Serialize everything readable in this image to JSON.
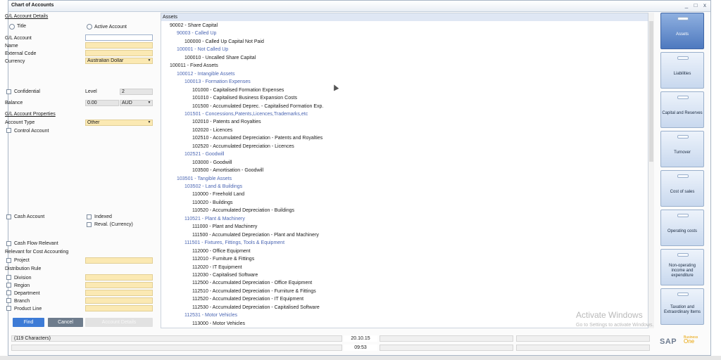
{
  "window": {
    "title": "Chart of Accounts",
    "controls": [
      "_",
      "□",
      "x"
    ]
  },
  "left_panel": {
    "gl_account_details": "G/L Account Details",
    "title_radio": "Title",
    "active_account_radio": "Active Account",
    "gl_account_label": "G/L Account",
    "gl_account_value": "",
    "name_label": "Name",
    "name_value": "",
    "external_code_label": "External Code",
    "external_code_value": "",
    "currency_label": "Currency",
    "currency_value": "Australian Dollar",
    "confidential_label": "Confidential",
    "level_label": "Level",
    "level_value": "2",
    "balance_label": "Balance",
    "balance_value": "0.00",
    "balance_currency": "AUD",
    "gl_account_properties": "G/L Account Properties",
    "account_type_label": "Account Type",
    "account_type_value": "Other",
    "control_account_label": "Control Account",
    "cash_account_label": "Cash Account",
    "indexed_label": "Indexed",
    "reval_label": "Reval. (Currency)",
    "cash_flow_label": "Cash Flow Relevant",
    "cost_accounting_label": "Relevant for Cost Accounting",
    "project_label": "Project",
    "distribution_rule_label": "Distribution Rule",
    "division_label": "Division",
    "region_label": "Region",
    "department_label": "Department",
    "branch_label": "Branch",
    "product_line_label": "Product Line",
    "find_button": "Find",
    "cancel_button": "Cancel",
    "disabled_button": "Account Details"
  },
  "tree": {
    "header": "Assets",
    "nodes": [
      {
        "text": "90002 - Share Capital",
        "level": 1,
        "kind": "acc"
      },
      {
        "text": "90003 - Called Up",
        "level": 2,
        "kind": "cat"
      },
      {
        "text": "100000 - Called Up Capital Not Paid",
        "level": 3,
        "kind": "acc"
      },
      {
        "text": "100001 - Not Called Up",
        "level": 2,
        "kind": "cat"
      },
      {
        "text": "100010 - Uncalled Share Capital",
        "level": 3,
        "kind": "acc"
      },
      {
        "text": "100011 - Fixed Assets",
        "level": 1,
        "kind": "acc"
      },
      {
        "text": "100012 - Intangible Assets",
        "level": 2,
        "kind": "cat"
      },
      {
        "text": "100013 - Formation Expenses",
        "level": 3,
        "kind": "cat"
      },
      {
        "text": "101000 - Capitalised Formation Expenses",
        "level": 4,
        "kind": "acc"
      },
      {
        "text": "101010 - Capitalised Business Expansion Costs",
        "level": 4,
        "kind": "acc"
      },
      {
        "text": "101500 - Accumulated Deprec. - Capitalised Formation Exp.",
        "level": 4,
        "kind": "acc"
      },
      {
        "text": "101501 - Concessions,Patents,Licences,Trademarks,etc",
        "level": 3,
        "kind": "cat"
      },
      {
        "text": "102010 - Patents and Royalties",
        "level": 4,
        "kind": "acc"
      },
      {
        "text": "102020 - Licences",
        "level": 4,
        "kind": "acc"
      },
      {
        "text": "102510 - Accumulated Depreciation - Patents and Royalties",
        "level": 4,
        "kind": "acc"
      },
      {
        "text": "102520 - Accumulated Depreciation - Licences",
        "level": 4,
        "kind": "acc"
      },
      {
        "text": "102521 - Goodwill",
        "level": 3,
        "kind": "cat"
      },
      {
        "text": "103000 - Goodwill",
        "level": 4,
        "kind": "acc"
      },
      {
        "text": "103500 - Amortisation - Goodwill",
        "level": 4,
        "kind": "acc"
      },
      {
        "text": "103501 - Tangible Assets",
        "level": 2,
        "kind": "cat"
      },
      {
        "text": "103502 - Land & Buildings",
        "level": 3,
        "kind": "cat"
      },
      {
        "text": "110000 - Freehold Land",
        "level": 4,
        "kind": "acc"
      },
      {
        "text": "110020 - Buildings",
        "level": 4,
        "kind": "acc"
      },
      {
        "text": "110520 - Accumulated Depreciation - Buildings",
        "level": 4,
        "kind": "acc"
      },
      {
        "text": "110521 - Plant & Machinery",
        "level": 3,
        "kind": "cat"
      },
      {
        "text": "111000 - Plant and Machinery",
        "level": 4,
        "kind": "acc"
      },
      {
        "text": "111500 - Accumulated Depreciation - Plant and Machinery",
        "level": 4,
        "kind": "acc"
      },
      {
        "text": "111501 - Fixtures, Fittings, Tools & Equipment",
        "level": 3,
        "kind": "cat"
      },
      {
        "text": "112000 - Office Equipment",
        "level": 4,
        "kind": "acc"
      },
      {
        "text": "112010 - Furniture & Fittings",
        "level": 4,
        "kind": "acc"
      },
      {
        "text": "112020 - IT Equipment",
        "level": 4,
        "kind": "acc"
      },
      {
        "text": "112030 - Capitalised Software",
        "level": 4,
        "kind": "acc"
      },
      {
        "text": "112500 - Accumulated Depreciation - Office Equipment",
        "level": 4,
        "kind": "acc"
      },
      {
        "text": "112510 - Accumulated Depreciation - Furniture & Fittings",
        "level": 4,
        "kind": "acc"
      },
      {
        "text": "112520 - Accumulated Depreciation - IT Equipment",
        "level": 4,
        "kind": "acc"
      },
      {
        "text": "112530 - Accumulated Depreciation - Capitalised Software",
        "level": 4,
        "kind": "acc"
      },
      {
        "text": "112531 - Motor Vehicles",
        "level": 3,
        "kind": "cat"
      },
      {
        "text": "113000 - Motor Vehicles",
        "level": 4,
        "kind": "acc"
      }
    ]
  },
  "drawers": [
    {
      "label": "Assets",
      "active": true
    },
    {
      "label": "Liabilities",
      "active": false
    },
    {
      "label": "Capital and Reserves",
      "active": false
    },
    {
      "label": "Turnover",
      "active": false
    },
    {
      "label": "Cost of sales",
      "active": false
    },
    {
      "label": "Operating costs",
      "active": false
    },
    {
      "label": "Non-operating income and expenditure",
      "active": false
    },
    {
      "label": "Taxation and Extraordinary Items",
      "active": false
    }
  ],
  "status_bar": {
    "message": "(119 Characters)",
    "date": "20.10.15",
    "time": "09:53"
  },
  "watermark": {
    "line1": "Activate Windows",
    "line2": "Go to Settings to activate Windows."
  },
  "logo": {
    "brand": "SAP",
    "sub1": "Business",
    "sub2": "One"
  },
  "colors": {
    "field_yellow": "#fbe9b3",
    "category_blue": "#4b66b3",
    "drawer_active": "#4e79bf",
    "find_button": "#3d7bd6",
    "cancel_button": "#6e7c8c"
  }
}
